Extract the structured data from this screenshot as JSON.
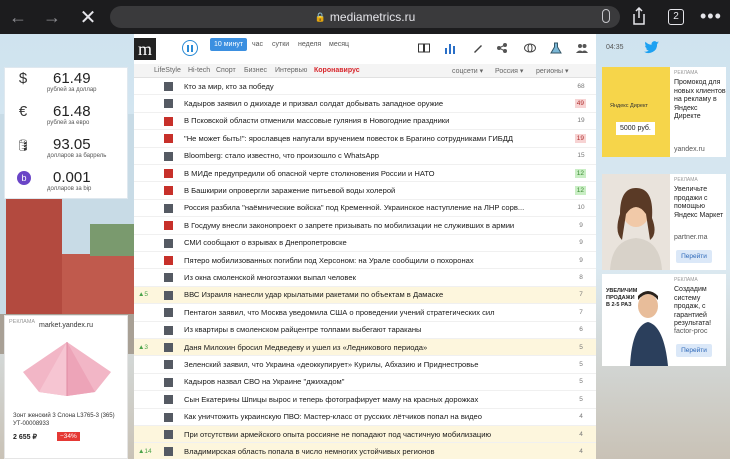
{
  "browser": {
    "url": "mediametrics.ru",
    "tab_count": "2"
  },
  "toolbar": {
    "logo": "m",
    "periods": [
      "10 минут",
      "час",
      "сутки",
      "неделя",
      "месяц"
    ],
    "clock": "04:35"
  },
  "menu": {
    "items": [
      "LifeStyle",
      "Hi-tech",
      "Спорт",
      "Бизнес",
      "Интервью"
    ],
    "hot": "Коронавирус",
    "dropdowns": [
      "соцсети ▾",
      "Россия ▾",
      "регионы ▾"
    ]
  },
  "currency": [
    {
      "symbol": "$",
      "value": "61.49",
      "caption": "рублей за доллар"
    },
    {
      "symbol": "€",
      "value": "61.48",
      "caption": "рублей за евро"
    },
    {
      "symbol": "🛢",
      "value": "93.05",
      "caption": "долларов за баррель"
    },
    {
      "symbol": "b",
      "value": "0.001",
      "caption": "долларов за bip"
    }
  ],
  "news": [
    {
      "title": "Кто за мир, кто за победу",
      "count": "68",
      "trend": "",
      "style": "",
      "src": "gray",
      "hl": false
    },
    {
      "title": "Кадыров заявил о джихаде и призвал солдат добывать западное оружие",
      "count": "49",
      "trend": "",
      "style": "red",
      "src": "gray",
      "hl": false
    },
    {
      "title": "В Псковской области отменили массовые гуляния в Новогодние праздники",
      "count": "19",
      "trend": "",
      "style": "",
      "src": "red",
      "hl": false
    },
    {
      "title": "\"Не может быть!\": ярославцев напугали вручением повесток в Брагино сотрудниками ГИБДД",
      "count": "19",
      "trend": "",
      "style": "red",
      "src": "red",
      "hl": false
    },
    {
      "title": "Bloomberg: стало известно, что произошло с WhatsApp",
      "count": "15",
      "trend": "",
      "style": "",
      "src": "gray",
      "hl": false
    },
    {
      "title": "В МИДе предупредили об опасной черте столкновения России и НАТО",
      "count": "12",
      "trend": "",
      "style": "green",
      "src": "red",
      "hl": false
    },
    {
      "title": "В Башкирии опровергли заражение питьевой воды холерой",
      "count": "12",
      "trend": "",
      "style": "green",
      "src": "red",
      "hl": false
    },
    {
      "title": "Россия разбила \"наёмнические войска\" под Кременной. Украинское наступление на ЛНР сорв...",
      "count": "10",
      "trend": "",
      "style": "",
      "src": "gray",
      "hl": false
    },
    {
      "title": "В Госдуму внесли законопроект о запрете призывать по мобилизации не служивших в армии",
      "count": "9",
      "trend": "",
      "style": "",
      "src": "red",
      "hl": false
    },
    {
      "title": "СМИ сообщают о взрывах в Днепропетровске",
      "count": "9",
      "trend": "",
      "style": "",
      "src": "gray",
      "hl": false
    },
    {
      "title": "Пятеро мобилизованных погибли под Херсоном: на Урале сообщили о похоронах",
      "count": "9",
      "trend": "",
      "style": "",
      "src": "red",
      "hl": false
    },
    {
      "title": "Из окна смоленской многоэтажки выпал человек",
      "count": "8",
      "trend": "",
      "style": "",
      "src": "gray",
      "hl": false
    },
    {
      "title": "ВВС Израиля нанесли удар крылатыми ракетами по объектам в Дамаске",
      "count": "7",
      "trend": "▲5",
      "style": "",
      "src": "gray",
      "hl": true
    },
    {
      "title": "Пентагон заявил, что Москва уведомила США о проведении учений стратегических сил",
      "count": "7",
      "trend": "",
      "style": "",
      "src": "gray",
      "hl": false
    },
    {
      "title": "Из квартиры в смоленском райцентре толпами выбегают тараканы",
      "count": "6",
      "trend": "",
      "style": "",
      "src": "gray",
      "hl": false
    },
    {
      "title": "Даня Милохин бросил Медведеву и ушел из «Ледникового периода»",
      "count": "5",
      "trend": "▲3",
      "style": "",
      "src": "gray",
      "hl": true
    },
    {
      "title": "Зеленский заявил, что Украина «деоккупирует» Курилы, Абхазию и Приднестровье",
      "count": "5",
      "trend": "",
      "style": "",
      "src": "gray",
      "hl": false
    },
    {
      "title": "Кадыров назвал СВО на Украине \"джихадом\"",
      "count": "5",
      "trend": "",
      "style": "",
      "src": "gray",
      "hl": false
    },
    {
      "title": "Сын Екатерины Шпицы вырос и теперь фотографирует маму на красных дорожках",
      "count": "5",
      "trend": "",
      "style": "",
      "src": "gray",
      "hl": false
    },
    {
      "title": "Как уничтожить украинскую ПВО: Мастер-класс от русских лётчиков попал на видео",
      "count": "4",
      "trend": "",
      "style": "",
      "src": "gray",
      "hl": false
    },
    {
      "title": "При отсутствии армейского опыта россияне не попадают под частичную мобилизацию",
      "count": "4",
      "trend": "",
      "style": "",
      "src": "gray",
      "hl": true
    },
    {
      "title": "Владимирская область попала в число немногих устойчивых регионов",
      "count": "4",
      "trend": "▲14",
      "style": "",
      "src": "gray",
      "hl": true
    }
  ],
  "ad_left": {
    "tag": "РЕКЛАМА",
    "market": "market.yandex.ru",
    "product": "Зонт женский 3 Слона L3765-3 (365) УТ-00008933",
    "price": "2 655 ₽",
    "discount": "−34%"
  },
  "ads_right": [
    {
      "tag": "РЕКЛАМА",
      "text": "Промокод для новых клиентов на рекламу в Яндекс Директе",
      "domain": "yandex.ru",
      "button": "",
      "banner": "Яндекс Директ",
      "banner_price": "5000 руб."
    },
    {
      "tag": "РЕКЛАМА",
      "text": "Увеличьте продажи с помощью Яндекс Маркет",
      "domain": "partner.ma",
      "button": "Перейти",
      "banner": "",
      "banner_price": ""
    },
    {
      "tag": "РЕКЛАМА",
      "text": "Создадим систему продаж, с гарантией результата!",
      "domain": "factor-proc",
      "button": "Перейти",
      "banner": "УВЕЛИЧИМ ПРОДАЖИ В 2-5 РАЗ",
      "banner_price": ""
    }
  ]
}
